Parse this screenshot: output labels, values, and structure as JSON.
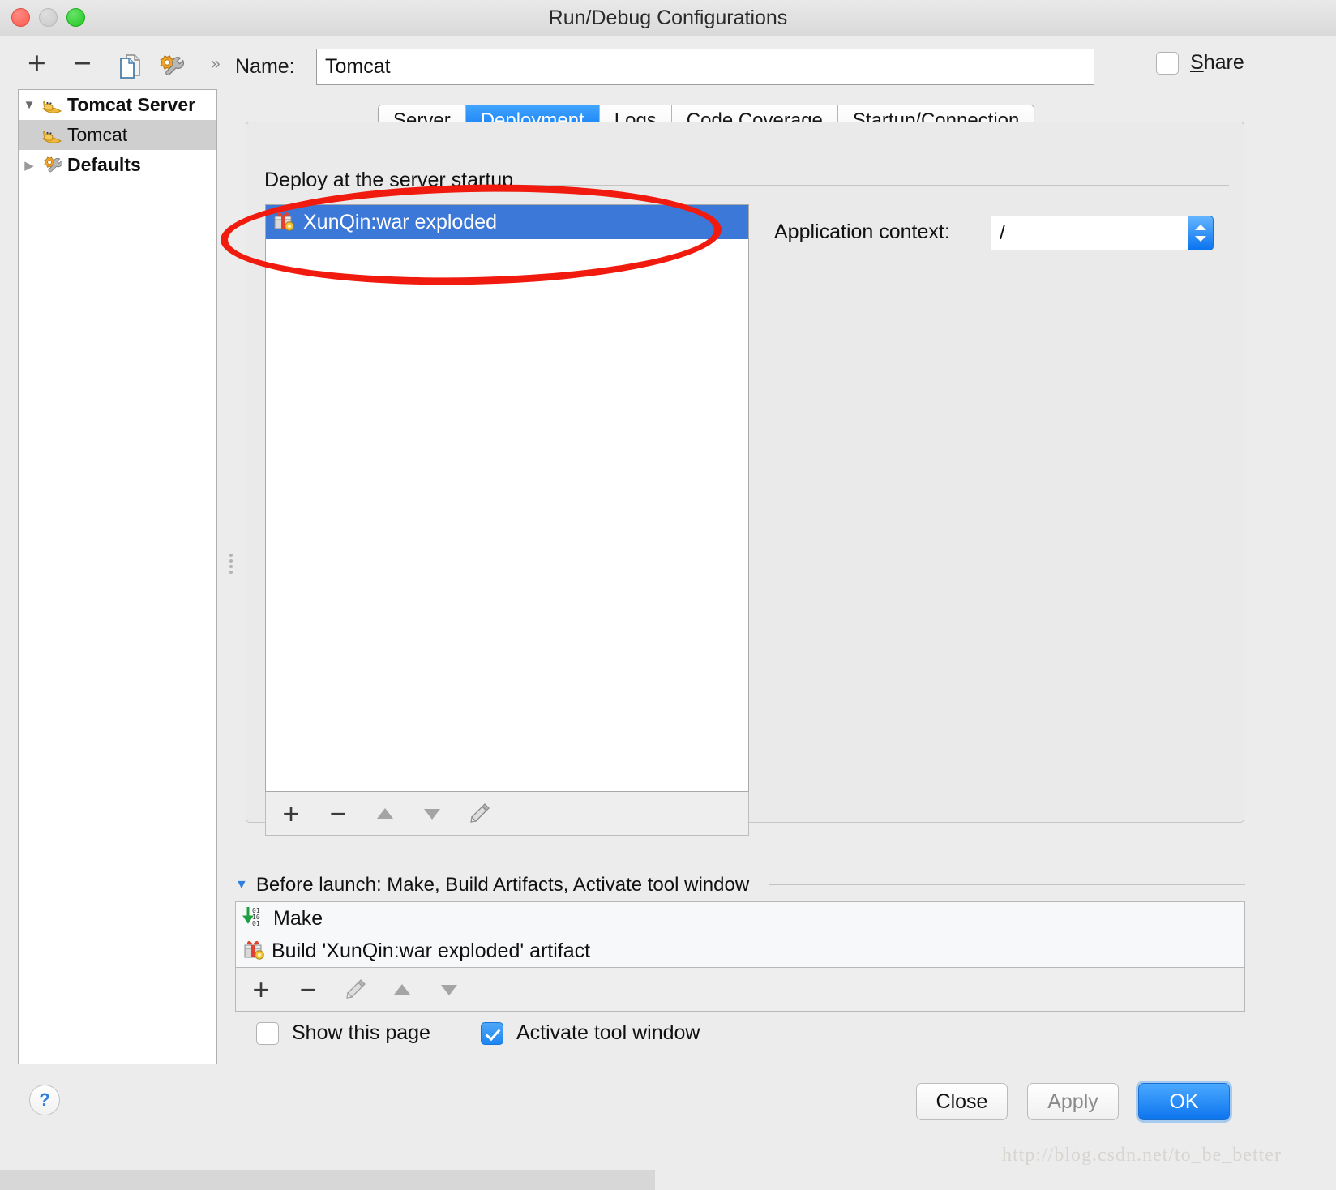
{
  "window": {
    "title": "Run/Debug Configurations",
    "controls": [
      "close-button",
      "minimize-button",
      "zoom-button"
    ]
  },
  "left_toolbar": {
    "items": [
      {
        "name": "add",
        "icon": "plus-icon",
        "label": "+"
      },
      {
        "name": "remove",
        "icon": "minus-icon",
        "label": "−"
      },
      {
        "name": "copy",
        "icon": "copy-icon",
        "label": ""
      },
      {
        "name": "edit-defaults",
        "icon": "wrench-icon",
        "label": ""
      },
      {
        "name": "more",
        "icon": "chevron-double-right-icon",
        "label": "»"
      }
    ]
  },
  "tree": {
    "nodes": [
      {
        "label": "Tomcat Server",
        "icon": "tomcat-cat-icon",
        "expanded": true,
        "bold": true,
        "selected": false,
        "triangle": "▼"
      },
      {
        "label": "Tomcat",
        "icon": "tomcat-cat-icon",
        "expanded": false,
        "bold": false,
        "selected": true,
        "triangle": ""
      },
      {
        "label": "Defaults",
        "icon": "wrench-icon",
        "expanded": false,
        "bold": true,
        "selected": false,
        "triangle": "▶"
      }
    ]
  },
  "help_button": {
    "label": "?"
  },
  "name_row": {
    "label": "Name:",
    "value": "Tomcat",
    "share": {
      "label_prefix": "",
      "label_underlined": "S",
      "label_rest": "hare",
      "checked": false
    }
  },
  "tabs": [
    {
      "label": "Server",
      "active": false
    },
    {
      "label": "Deployment",
      "active": true
    },
    {
      "label": "Logs",
      "active": false
    },
    {
      "label": "Code Coverage",
      "active": false
    },
    {
      "label": "Startup/Connection",
      "active": false
    }
  ],
  "deployment": {
    "group_label": "Deploy at the server startup",
    "artifacts": [
      {
        "label": "XunQin:war exploded",
        "icon": "artifact-gift-icon",
        "selected": true
      }
    ],
    "toolbar": [
      {
        "name": "add-artifact",
        "icon": "plus-icon",
        "label": "+"
      },
      {
        "name": "remove-artifact",
        "icon": "minus-icon",
        "label": "−"
      },
      {
        "name": "move-up",
        "icon": "triangle-up-icon",
        "label": ""
      },
      {
        "name": "move-down",
        "icon": "triangle-down-icon",
        "label": ""
      },
      {
        "name": "edit-artifact",
        "icon": "pencil-icon",
        "label": ""
      }
    ],
    "application_context": {
      "label": "Application context:",
      "value": "/"
    }
  },
  "before_launch": {
    "triangle": "▼",
    "header": "Before launch: Make, Build Artifacts, Activate tool window",
    "tasks": [
      {
        "label": "Make",
        "icon": "make-binary-arrow-icon"
      },
      {
        "label": "Build 'XunQin:war exploded' artifact",
        "icon": "artifact-gift-icon"
      }
    ],
    "toolbar": [
      {
        "name": "add-task",
        "icon": "plus-icon",
        "label": "+"
      },
      {
        "name": "remove-task",
        "icon": "minus-icon",
        "label": "−"
      },
      {
        "name": "edit-task",
        "icon": "pencil-icon",
        "label": ""
      },
      {
        "name": "move-task-up",
        "icon": "triangle-up-icon",
        "label": ""
      },
      {
        "name": "move-task-down",
        "icon": "triangle-down-icon",
        "label": ""
      }
    ],
    "checkboxes": [
      {
        "label": "Show this page",
        "checked": false
      },
      {
        "label": "Activate tool window",
        "checked": true
      }
    ]
  },
  "footer_buttons": [
    {
      "label": "Close",
      "style": "normal"
    },
    {
      "label": "Apply",
      "style": "disabled"
    },
    {
      "label": "OK",
      "style": "primary"
    }
  ],
  "annotation": {
    "shape": "red-ellipse",
    "color": "#f01b0e"
  },
  "watermark": {
    "text": "http://blog.csdn.net/to_be_better"
  }
}
